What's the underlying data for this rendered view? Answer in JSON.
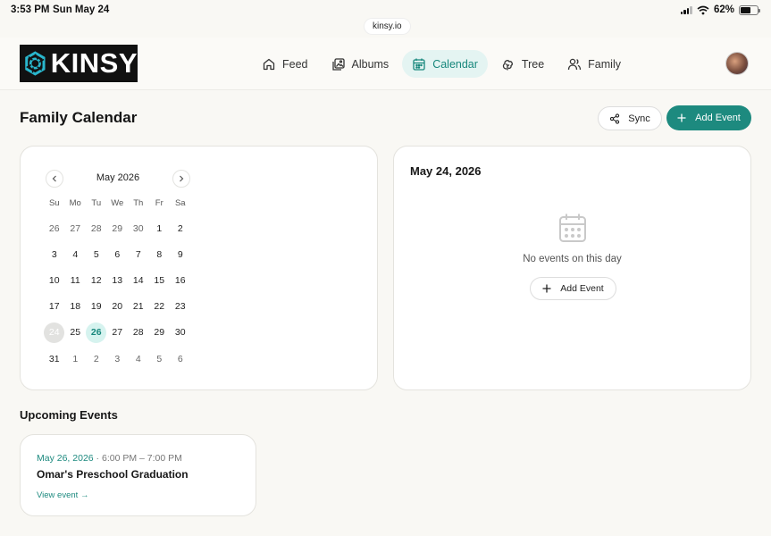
{
  "status_bar": {
    "time": "3:53 PM",
    "date": "Sun May 24",
    "battery": "62%"
  },
  "browser": {
    "url": "kinsy.io"
  },
  "brand": {
    "name": "KINSY",
    "accent": "#1d8a7f"
  },
  "nav": {
    "items": [
      {
        "label": "Feed",
        "icon": "home-icon"
      },
      {
        "label": "Albums",
        "icon": "albums-icon"
      },
      {
        "label": "Calendar",
        "icon": "calendar-icon",
        "active": true
      },
      {
        "label": "Tree",
        "icon": "tree-icon"
      },
      {
        "label": "Family",
        "icon": "family-icon"
      }
    ]
  },
  "page": {
    "title": "Family Calendar",
    "sync_label": "Sync",
    "add_event_label": "Add Event"
  },
  "calendar": {
    "month_label": "May 2026",
    "weekdays": [
      "Su",
      "Mo",
      "Tu",
      "We",
      "Th",
      "Fr",
      "Sa"
    ],
    "selected_day": 24,
    "today_day": 26,
    "days": [
      {
        "n": "26",
        "muted": true
      },
      {
        "n": "27",
        "muted": true
      },
      {
        "n": "28",
        "muted": true
      },
      {
        "n": "29",
        "muted": true
      },
      {
        "n": "30",
        "muted": true
      },
      {
        "n": "1"
      },
      {
        "n": "2"
      },
      {
        "n": "3"
      },
      {
        "n": "4"
      },
      {
        "n": "5"
      },
      {
        "n": "6"
      },
      {
        "n": "7"
      },
      {
        "n": "8"
      },
      {
        "n": "9"
      },
      {
        "n": "10"
      },
      {
        "n": "11"
      },
      {
        "n": "12"
      },
      {
        "n": "13"
      },
      {
        "n": "14"
      },
      {
        "n": "15"
      },
      {
        "n": "16"
      },
      {
        "n": "17"
      },
      {
        "n": "18"
      },
      {
        "n": "19"
      },
      {
        "n": "20"
      },
      {
        "n": "21"
      },
      {
        "n": "22"
      },
      {
        "n": "23"
      },
      {
        "n": "24",
        "selected": true
      },
      {
        "n": "25"
      },
      {
        "n": "26",
        "today": true
      },
      {
        "n": "27"
      },
      {
        "n": "28"
      },
      {
        "n": "29"
      },
      {
        "n": "30"
      },
      {
        "n": "31"
      },
      {
        "n": "1",
        "muted": true
      },
      {
        "n": "2",
        "muted": true
      },
      {
        "n": "3",
        "muted": true
      },
      {
        "n": "4",
        "muted": true
      },
      {
        "n": "5",
        "muted": true
      },
      {
        "n": "6",
        "muted": true
      }
    ]
  },
  "day_panel": {
    "title": "May 24, 2026",
    "empty_text": "No events on this day",
    "add_label": "Add Event"
  },
  "upcoming": {
    "title": "Upcoming Events",
    "events": [
      {
        "date": "May 26, 2026",
        "separator": " · ",
        "time": "6:00 PM – 7:00 PM",
        "title": "Omar's Preschool Graduation",
        "link": "View event →"
      }
    ]
  }
}
